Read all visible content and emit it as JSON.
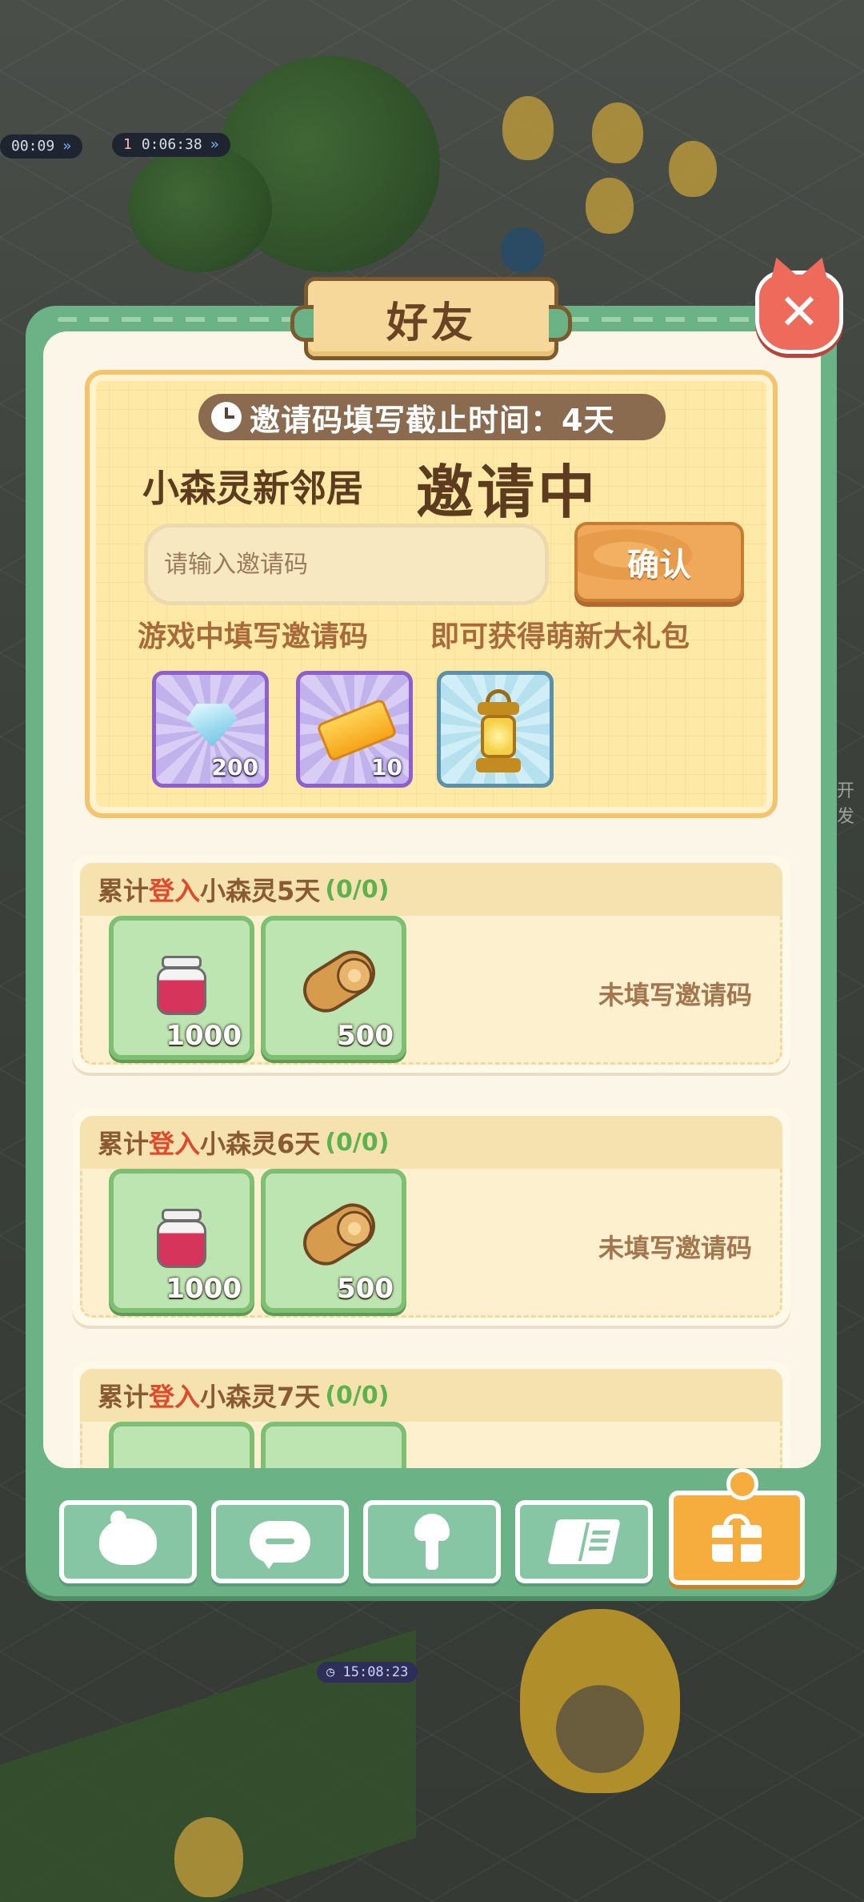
{
  "background": {
    "timers": [
      "00:09",
      "0:06:38"
    ],
    "bottom_timer": "15:08:23",
    "level_badge": "1",
    "side_text": "开发"
  },
  "panel": {
    "title": "好友",
    "close_icon": "close-icon"
  },
  "invite": {
    "deadline_label": "邀请码填写截止时间：4天",
    "headline_prefix": "小森灵新邻居",
    "headline_main": "邀请中",
    "input_placeholder": "请输入邀请码",
    "input_value": "",
    "confirm_label": "确认",
    "caption_left": "游戏中填写邀请码",
    "caption_right": "即可获得萌新大礼包",
    "rewards": [
      {
        "icon": "diamond-icon",
        "count": "200"
      },
      {
        "icon": "ticket-icon",
        "count": "10"
      },
      {
        "icon": "lantern-icon",
        "count": ""
      }
    ]
  },
  "tasks": [
    {
      "prefix": "累计",
      "highlight": "登入",
      "suffix": "小森灵5天",
      "progress": "(0/0)",
      "items": [
        {
          "icon": "jam-jar-icon",
          "count": "1000"
        },
        {
          "icon": "wood-log-icon",
          "count": "500"
        }
      ],
      "status": "未填写邀请码"
    },
    {
      "prefix": "累计",
      "highlight": "登入",
      "suffix": "小森灵6天",
      "progress": "(0/0)",
      "items": [
        {
          "icon": "jam-jar-icon",
          "count": "1000"
        },
        {
          "icon": "wood-log-icon",
          "count": "500"
        }
      ],
      "status": "未填写邀请码"
    },
    {
      "prefix": "累计",
      "highlight": "登入",
      "suffix": "小森灵7天",
      "progress": "(0/0)"
    }
  ],
  "bottom_tabs": [
    {
      "icon": "chick-icon",
      "active": false
    },
    {
      "icon": "chat-bubble-icon",
      "active": false
    },
    {
      "icon": "wrench-icon",
      "active": false
    },
    {
      "icon": "book-icon",
      "active": false
    },
    {
      "icon": "gift-icon",
      "active": true
    }
  ],
  "colors": {
    "panel_green": "#6bb286",
    "highlight_red": "#e04a2c",
    "progress_green": "#5cb24c",
    "active_tab": "#f7ad3e",
    "item_tile_green": "#bde5b1"
  }
}
